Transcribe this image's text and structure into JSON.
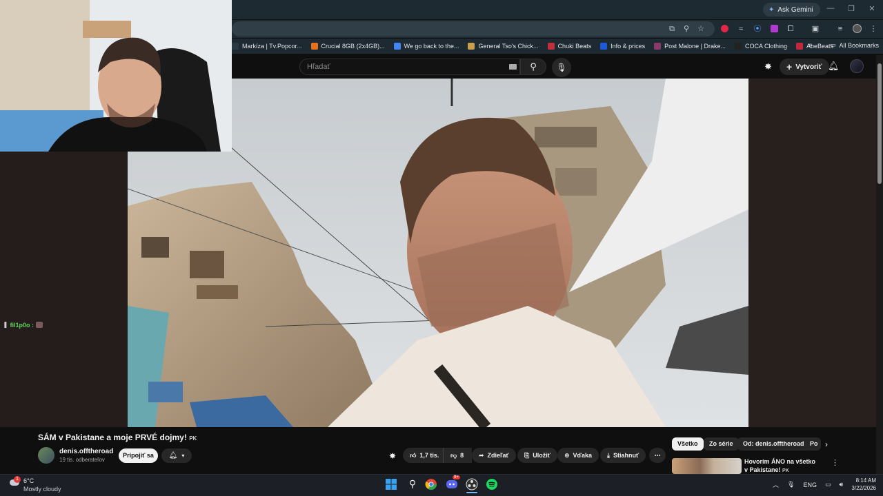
{
  "browser": {
    "ask_gemini": "Ask Gemini",
    "bookmarks": [
      {
        "label": "Markíza | Tv.Popcor...",
        "icon": "generic-page-icon",
        "color": "#2a3a44"
      },
      {
        "label": "Crucial 8GB (2x4GB)...",
        "icon": "crucial-icon",
        "color": "#e8721c"
      },
      {
        "label": "We go back to the...",
        "icon": "google-icon",
        "color": "#4285f4"
      },
      {
        "label": "General Tso's Chick...",
        "icon": "recipe-icon",
        "color": "#c8a050"
      },
      {
        "label": "Chuki Beats",
        "icon": "chuki-icon",
        "color": "#c0303a"
      },
      {
        "label": "Info & prices",
        "icon": "b-icon",
        "color": "#1e5ad6"
      },
      {
        "label": "Post Malone | Drake...",
        "icon": "music-icon",
        "color": "#8a3a6a"
      },
      {
        "label": "COCA Clothing",
        "icon": "coca-icon",
        "color": "#222222"
      },
      {
        "label": "AbeBeats",
        "icon": "abebeats-icon",
        "color": "#c02a3a"
      }
    ],
    "all_bookmarks": "All Bookmarks"
  },
  "youtube": {
    "search_placeholder": "Hľadať",
    "create_label": "Vytvoriť",
    "video_title": "SÁM v Pakistane a moje PRVÉ dojmy!",
    "title_flag": "PK",
    "channel_name": "denis.offtheroad",
    "subscribers": "19 tis. odberateľov",
    "join_label": "Pripojiť sa",
    "likes": "1,7 tis.",
    "dislikes": "8",
    "share_label": "Zdieľať",
    "save_label": "Uložiť",
    "thanks_label": "Vďaka",
    "download_label": "Stiahnuť",
    "chips": [
      "Všetko",
      "Zo série",
      "Od: denis.offtheroad",
      "Po"
    ],
    "recommended": {
      "title": "Hovorím ÁNO na všetko v Pakistane!",
      "flag": "PK"
    }
  },
  "stream_chat": {
    "user": "fil1p0o :"
  },
  "taskbar": {
    "temperature": "6°C",
    "weather": "Mostly cloudy",
    "weather_badge": "1",
    "language": "ENG",
    "time": "8:14 AM",
    "date": "3/22/2026",
    "discord_badge": "9+"
  },
  "colors": {
    "accent_green": "#5dd65d",
    "yt_bg": "#0f0f0f",
    "chrome_bg": "#1e2a31"
  }
}
